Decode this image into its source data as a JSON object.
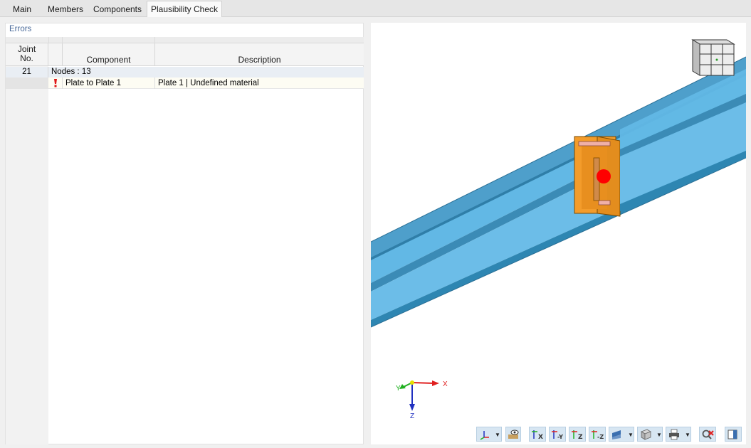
{
  "tabs": [
    {
      "label": "Main",
      "active": false
    },
    {
      "label": "Members",
      "active": false
    },
    {
      "label": "Components",
      "active": false
    },
    {
      "label": "Plausibility Check",
      "active": true
    }
  ],
  "errors_panel": {
    "title": "Errors",
    "columns": {
      "joint_line1": "Joint",
      "joint_line2": "No.",
      "component": "Component",
      "description": "Description"
    },
    "groups": [
      {
        "joint_no": "21",
        "label": "Nodes : 13",
        "rows": [
          {
            "status_icon": "error-exclamation-icon",
            "component": "Plate to Plate 1",
            "description": "Plate 1 | Undefined material"
          }
        ]
      }
    ]
  },
  "viewport": {
    "axes": {
      "x": "X",
      "y": "Y",
      "z": "Z"
    },
    "colors": {
      "beam": "#65b9e6",
      "beam_top": "#4a9ec9",
      "plate": "#f39c2b",
      "error_marker": "#ff0000",
      "axis_x": "#e02020",
      "axis_y": "#20b020",
      "axis_z": "#2030c0",
      "toolbar_button": "#d7e6f2"
    },
    "toolbar": [
      {
        "icon": "axes-dropdown-icon"
      },
      {
        "icon": "view-eye-icon"
      },
      {
        "icon": "view-x-icon"
      },
      {
        "icon": "view-minus-y-icon"
      },
      {
        "icon": "view-z-icon"
      },
      {
        "icon": "view-minus-z-icon"
      },
      {
        "icon": "display-mode-icon"
      },
      {
        "icon": "box-view-icon"
      },
      {
        "icon": "print-icon"
      },
      {
        "icon": "reset-view-icon"
      },
      {
        "icon": "panel-toggle-icon"
      }
    ]
  }
}
